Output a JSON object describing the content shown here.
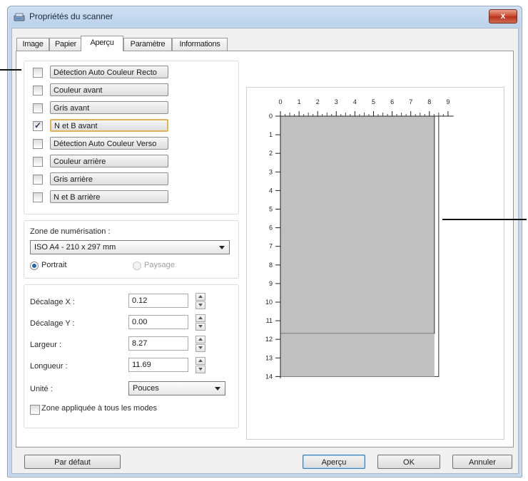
{
  "window": {
    "title": "Propriétés du scanner",
    "close_label": "x"
  },
  "tabs": [
    {
      "label": "Image"
    },
    {
      "label": "Papier"
    },
    {
      "label": "Aperçu"
    },
    {
      "label": "Paramètre"
    },
    {
      "label": "Informations"
    }
  ],
  "active_tab": "Aperçu",
  "image_options": [
    {
      "label": "Détection Auto Couleur Recto",
      "checked": false
    },
    {
      "label": "Couleur avant",
      "checked": false
    },
    {
      "label": "Gris avant",
      "checked": false
    },
    {
      "label": "N et B avant",
      "checked": true,
      "selected": true
    },
    {
      "label": "Détection Auto Couleur Verso",
      "checked": false
    },
    {
      "label": "Couleur arrière",
      "checked": false
    },
    {
      "label": "Gris arrière",
      "checked": false
    },
    {
      "label": "N et B arrière",
      "checked": false
    }
  ],
  "scan_area": {
    "label": "Zone de numérisation :",
    "selected": "ISO A4 - 210 x 297 mm",
    "portrait_label": "Portrait",
    "landscape_label": "Paysage",
    "orientation": "Portrait"
  },
  "fields": {
    "offset_x": {
      "label": "Décalage X :",
      "value": "0.12"
    },
    "offset_y": {
      "label": "Décalage Y :",
      "value": "0.00"
    },
    "width": {
      "label": "Largeur :",
      "value": "8.27"
    },
    "length": {
      "label": "Longueur :",
      "value": "11.69"
    }
  },
  "unit": {
    "label": "Unité :",
    "selected": "Pouces"
  },
  "apply_all": {
    "label": "Zone appliquée à tous les modes",
    "checked": false
  },
  "preview": {
    "h_ruler_labels": [
      "0",
      "1",
      "2",
      "3",
      "4",
      "5",
      "6",
      "7",
      "8",
      "9"
    ],
    "v_ruler_labels": [
      "0",
      "1",
      "2",
      "3",
      "4",
      "5",
      "6",
      "7",
      "8",
      "9",
      "10",
      "11",
      "12",
      "13",
      "14"
    ],
    "page_width_in": 8.5,
    "page_length_in": 14,
    "scan_width_in": 8.27,
    "scan_length_in": 11.69,
    "colors": {
      "scan_fill": "#c0c0c0",
      "scan_border": "#333333"
    }
  },
  "buttons": {
    "default_label": "Par défaut",
    "preview_label": "Aperçu",
    "ok_label": "OK",
    "cancel_label": "Annuler"
  }
}
